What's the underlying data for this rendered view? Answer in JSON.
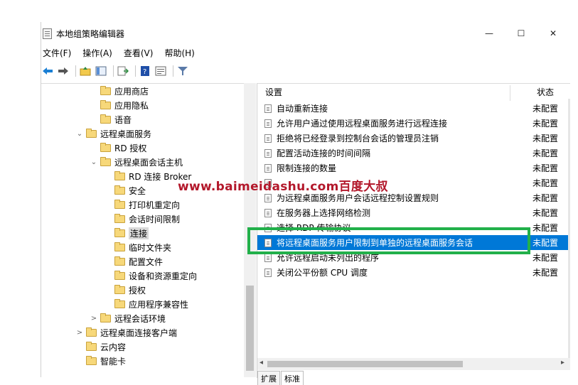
{
  "window": {
    "title": "本地组策略编辑器",
    "minimize": "—",
    "maximize": "☐",
    "close": "✕"
  },
  "menu": [
    "文件(F)",
    "操作(A)",
    "查看(V)",
    "帮助(H)"
  ],
  "toolbar": {
    "icons": [
      "back-arrow-icon",
      "forward-arrow-icon",
      "folder-up-icon",
      "show-hide-tree-icon",
      "export-list-icon",
      "help-icon",
      "properties-icon",
      "filter-icon"
    ]
  },
  "tree": [
    {
      "label": "应用商店",
      "caret": ""
    },
    {
      "label": "应用隐私",
      "caret": ""
    },
    {
      "label": "语音",
      "caret": ""
    },
    {
      "label": "远程桌面服务",
      "caret": "⌄"
    },
    {
      "label": "RD 授权",
      "caret": ""
    },
    {
      "label": "远程桌面会话主机",
      "caret": "⌄"
    },
    {
      "label": "RD 连接 Broker",
      "caret": ""
    },
    {
      "label": "安全",
      "caret": ""
    },
    {
      "label": "打印机重定向",
      "caret": ""
    },
    {
      "label": "会话时间限制",
      "caret": ""
    },
    {
      "label": "连接",
      "caret": ""
    },
    {
      "label": "临时文件夹",
      "caret": ""
    },
    {
      "label": "配置文件",
      "caret": ""
    },
    {
      "label": "设备和资源重定向",
      "caret": ""
    },
    {
      "label": "授权",
      "caret": ""
    },
    {
      "label": "应用程序兼容性",
      "caret": ""
    },
    {
      "label": "远程会话环境",
      "caret": ">"
    },
    {
      "label": "远程桌面连接客户端",
      "caret": ">"
    },
    {
      "label": "云内容",
      "caret": ""
    },
    {
      "label": "智能卡",
      "caret": ""
    }
  ],
  "list": {
    "col_setting": "设置",
    "col_state": "状态",
    "rows": [
      {
        "name": "自动重新连接",
        "state": "未配置"
      },
      {
        "name": "允许用户通过使用远程桌面服务进行远程连接",
        "state": "未配置"
      },
      {
        "name": "拒绝将已经登录到控制台会话的管理员注销",
        "state": "未配置"
      },
      {
        "name": "配置活动连接的时间间隔",
        "state": "未配置"
      },
      {
        "name": "限制连接的数量",
        "state": "未配置"
      },
      {
        "name": "",
        "state": "未配置"
      },
      {
        "name": "为远程桌面服务用户会话远程控制设置规则",
        "state": "未配置"
      },
      {
        "name": "在服务器上选择网络检测",
        "state": "未配置"
      },
      {
        "name": "选择 RDP 传输协议",
        "state": "未配置"
      },
      {
        "name": "将远程桌面服务用户限制到单独的远程桌面服务会话",
        "state": "未配置"
      },
      {
        "name": "允许远程启动未列出的程序",
        "state": "未配置"
      },
      {
        "name": "关闭公平份额 CPU 调度",
        "state": "未配置"
      }
    ]
  },
  "tabs": [
    "扩展",
    "标准"
  ],
  "watermark": "www.baimeidashu.com百度大叔",
  "colors": {
    "selection": "#0078d7",
    "annotation": "#22b04a",
    "watermark": "#b3182b"
  }
}
